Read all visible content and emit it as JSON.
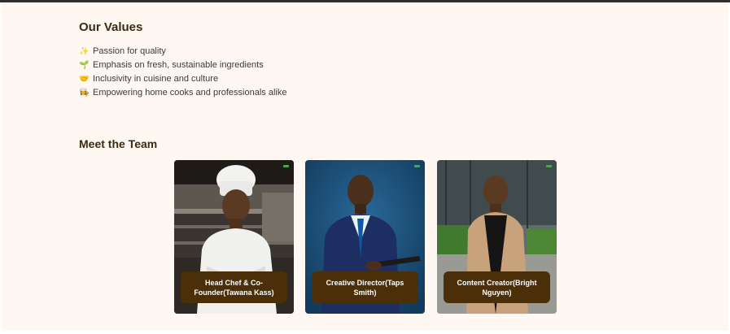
{
  "values": {
    "title": "Our Values",
    "items": [
      {
        "icon": "✨",
        "icon_name": "sparkles-icon",
        "text": "Passion for quality"
      },
      {
        "icon": "🌱",
        "icon_name": "seedling-icon",
        "text": "Emphasis on fresh, sustainable ingredients"
      },
      {
        "icon": "🤝",
        "icon_name": "handshake-icon",
        "text": "Inclusivity in cuisine and culture"
      },
      {
        "icon": "👩‍🍳",
        "icon_name": "cook-icon",
        "text": "Empowering home cooks and professionals alike"
      }
    ]
  },
  "team": {
    "title": "Meet the Team",
    "members": [
      {
        "caption": "Head Chef & Co-Founder(Tawana Kass)"
      },
      {
        "caption": "Creative Director(Taps Smith)"
      },
      {
        "caption": "Content Creator(Bright Nguyen)"
      }
    ]
  },
  "colors": {
    "page_background": "#fff8f2",
    "heading": "#3b2a0f",
    "caption_background": "#4a2f08",
    "caption_text": "#ffffff"
  }
}
